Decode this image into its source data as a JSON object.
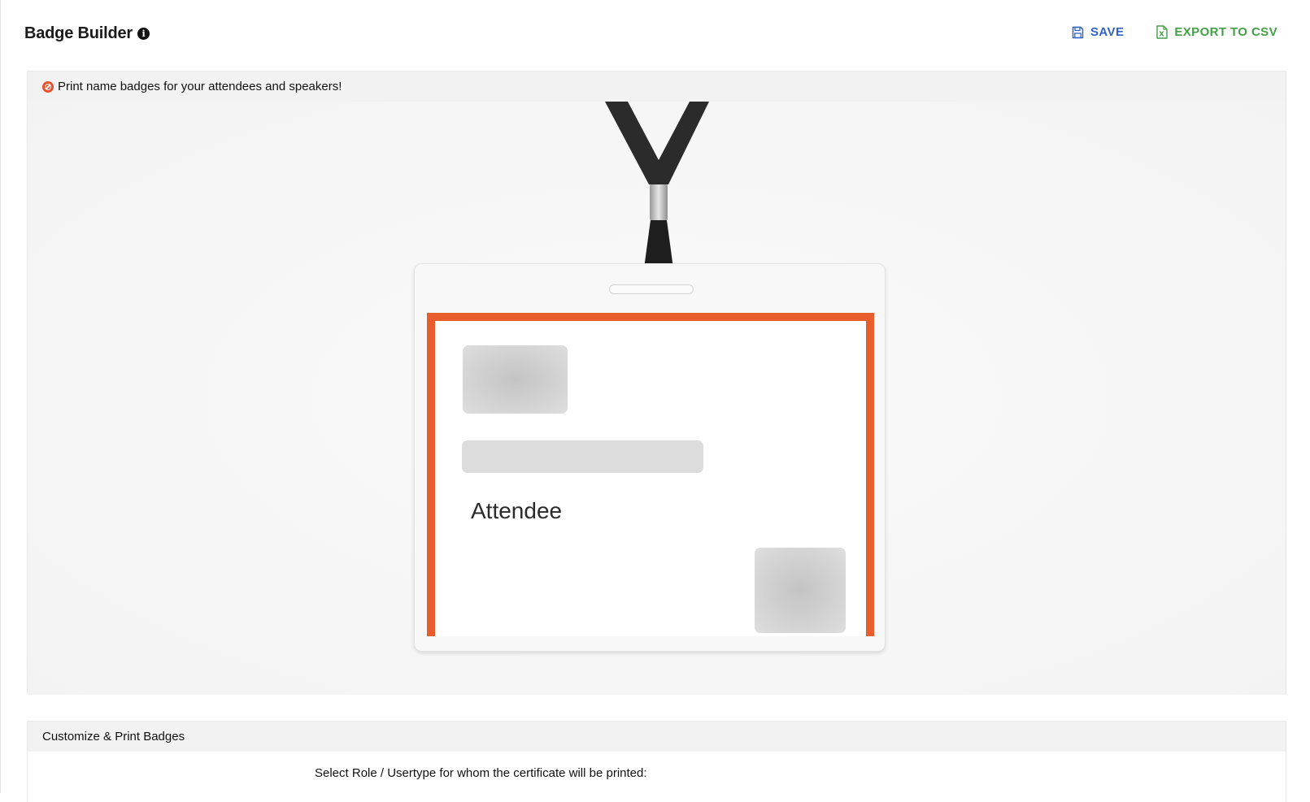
{
  "header": {
    "title": "Badge Builder",
    "info_icon": "info-circle-icon"
  },
  "toolbar": {
    "save_label": "SAVE",
    "save_icon": "floppy-disk-icon",
    "export_label": "EXPORT TO CSV",
    "export_icon": "excel-file-icon",
    "save_color": "#2f64c4",
    "export_color": "#43a047"
  },
  "preview": {
    "notice": "Print name badges for your attendees and speakers!",
    "notice_icon": "alert-circle-icon",
    "badge": {
      "role": "Attendee",
      "accent_color": "#e85d2c"
    }
  },
  "customize": {
    "title": "Customize & Print Badges",
    "select_label": "Select Role / Usertype for whom the certificate will be printed:"
  }
}
